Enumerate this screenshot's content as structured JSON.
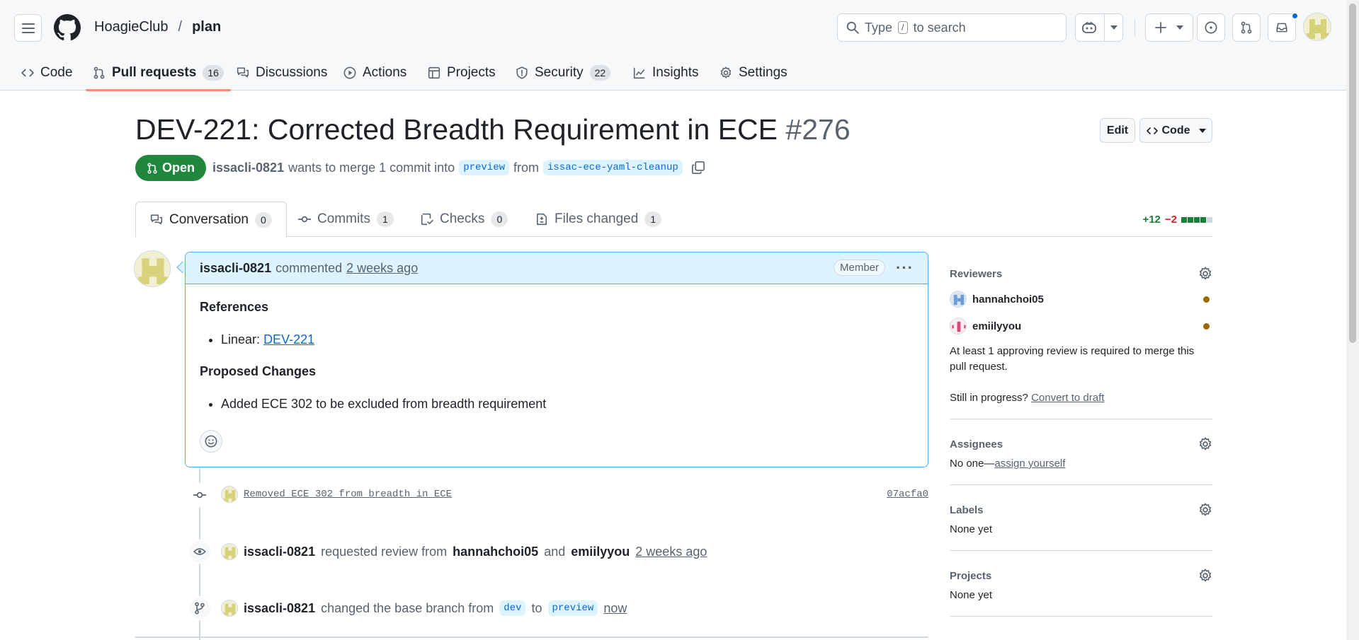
{
  "header": {
    "org": "HoagieClub",
    "separator": "/",
    "repo": "plan",
    "search": {
      "before": "Type",
      "key": "/",
      "after": "to search"
    }
  },
  "repo_nav": [
    {
      "label": "Code",
      "icon": "code-icon"
    },
    {
      "label": "Pull requests",
      "count": "16",
      "icon": "git-pull-request-icon",
      "active": true
    },
    {
      "label": "Discussions",
      "icon": "comment-discussion-icon"
    },
    {
      "label": "Actions",
      "icon": "play-icon"
    },
    {
      "label": "Projects",
      "icon": "table-icon"
    },
    {
      "label": "Security",
      "count": "22",
      "icon": "shield-icon"
    },
    {
      "label": "Insights",
      "icon": "graph-icon"
    },
    {
      "label": "Settings",
      "icon": "gear-icon"
    }
  ],
  "pr": {
    "title": "DEV-221: Corrected Breadth Requirement in ECE",
    "number": "#276",
    "edit_label": "Edit",
    "code_label": "Code",
    "state": "Open",
    "author": "issacli-0821",
    "merge_text": "wants to merge 1 commit into",
    "base_branch": "preview",
    "from_text": "from",
    "head_branch": "issac-ece-yaml-cleanup"
  },
  "pr_tabs": [
    {
      "label": "Conversation",
      "count": "0"
    },
    {
      "label": "Commits",
      "count": "1"
    },
    {
      "label": "Checks",
      "count": "0"
    },
    {
      "label": "Files changed",
      "count": "1"
    }
  ],
  "diffstat": {
    "additions": "+12",
    "deletions": "−2",
    "blocks_added": 4,
    "blocks_total": 5
  },
  "comment": {
    "author": "issacli-0821",
    "action": "commented",
    "when": "2 weeks ago",
    "badge": "Member",
    "references_heading": "References",
    "linear_label": "Linear:",
    "linear_link": "DEV-221",
    "changes_heading": "Proposed Changes",
    "change_item": "Added ECE 302 to be excluded from breadth requirement"
  },
  "timeline": {
    "commit_message": "Removed ECE 302 from breadth in ECE",
    "commit_sha": "07acfa0",
    "review_actor": "issacli-0821",
    "review_text": "requested review from",
    "review_user1": "hannahchoi05",
    "review_and": "and",
    "review_user2": "emiilyyou",
    "review_when": "2 weeks ago",
    "base_actor": "issacli-0821",
    "base_text": "changed the base branch from",
    "base_from": "dev",
    "base_to_text": "to",
    "base_to": "preview",
    "base_when": "now"
  },
  "sidebar": {
    "reviewers_label": "Reviewers",
    "reviewers": [
      {
        "name": "hannahchoi05",
        "status_color": "#9a6700"
      },
      {
        "name": "emiilyyou",
        "status_color": "#9a6700"
      }
    ],
    "approval_note": "At least 1 approving review is required to merge this pull request.",
    "still_in_progress": "Still in progress?",
    "convert_to_draft": "Convert to draft",
    "assignees_label": "Assignees",
    "assignees_none": "No one—",
    "assign_yourself": "assign yourself",
    "labels_label": "Labels",
    "labels_none": "None yet",
    "projects_label": "Projects",
    "projects_none": "None yet"
  },
  "colors": {
    "open_green": "#1f883d",
    "accent_blue": "#0969da",
    "tab_underline": "#fd8c73",
    "comment_header_bg": "#ddf4ff"
  }
}
